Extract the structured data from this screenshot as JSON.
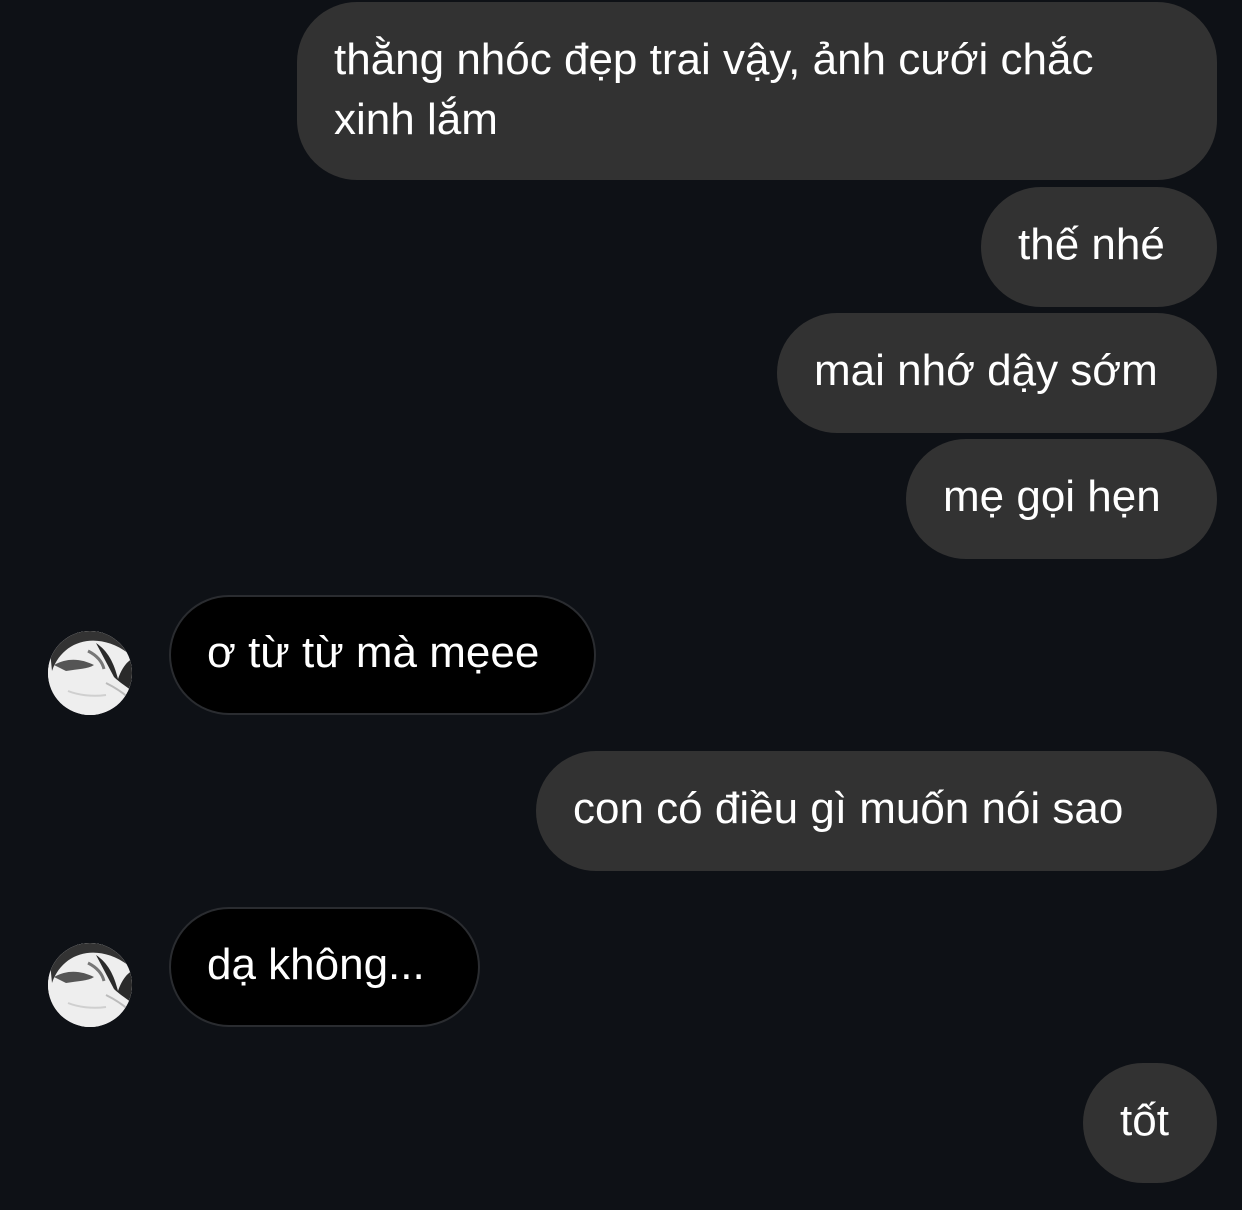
{
  "messages": [
    {
      "direction": "outgoing",
      "text": "thằng nhóc đẹp trai vậy, ảnh cưới chắc\nxinh lắm"
    },
    {
      "direction": "outgoing",
      "text": "thế nhé"
    },
    {
      "direction": "outgoing",
      "text": "mai nhớ dậy sớm"
    },
    {
      "direction": "outgoing",
      "text": "mẹ gọi hẹn"
    },
    {
      "direction": "incoming",
      "text": "ơ từ từ mà mẹee"
    },
    {
      "direction": "outgoing",
      "text": "con có điều gì muốn nói sao"
    },
    {
      "direction": "incoming",
      "text": "dạ không..."
    },
    {
      "direction": "outgoing",
      "text": "tốt"
    }
  ],
  "colors": {
    "background": "#0e1116",
    "outgoing_bubble": "#323232",
    "incoming_bubble": "#000000",
    "text": "#ffffff"
  }
}
